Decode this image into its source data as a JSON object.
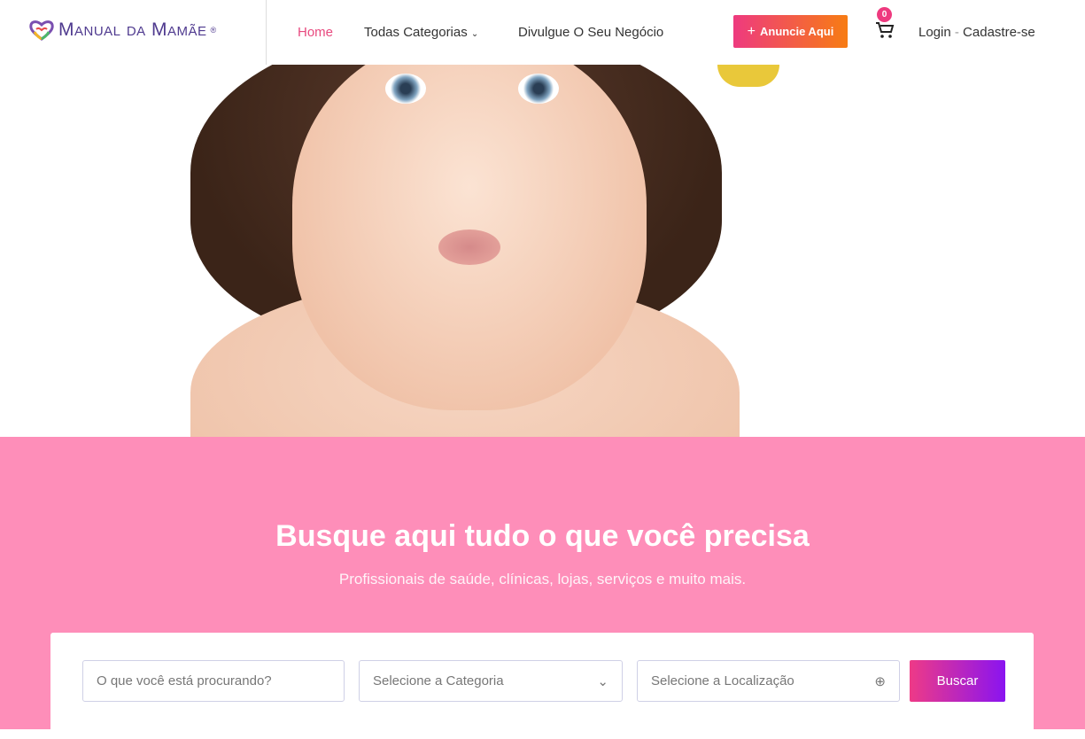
{
  "header": {
    "logo_text": "Manual da Mamãe",
    "logo_mark": "®",
    "nav": [
      {
        "label": "Home",
        "active": true
      },
      {
        "label": "Todas Categorias",
        "has_dropdown": true
      },
      {
        "label": "Divulgue O Seu Negócio"
      }
    ],
    "cta_label": "Anuncie Aqui",
    "cart_count": "0",
    "login": "Login",
    "separator": "-",
    "register": "Cadastre-se"
  },
  "hero": {
    "title": "Busque aqui tudo o que você precisa",
    "subtitle": "Profissionais de saúde, clínicas, lojas, serviços e muito mais."
  },
  "search": {
    "query_placeholder": "O que você está procurando?",
    "category_placeholder": "Selecione a Categoria",
    "location_placeholder": "Selecione a Localização",
    "button_label": "Buscar"
  },
  "colors": {
    "accent": "#e84a7f",
    "band": "#fe8eb9",
    "logo": "#4f3a8f"
  }
}
